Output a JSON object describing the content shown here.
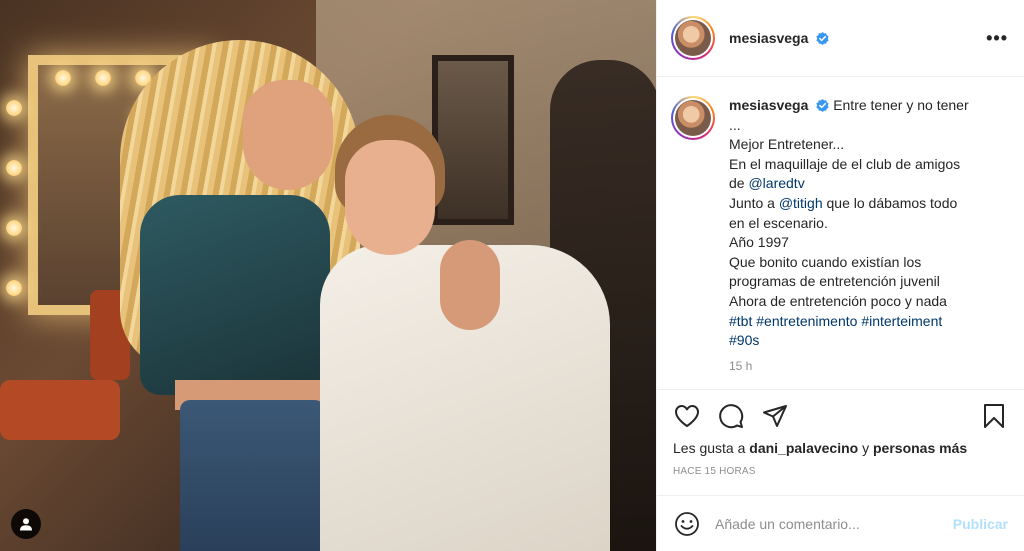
{
  "post": {
    "username": "mesiasvega",
    "more_icon": "more-horizontal-icon",
    "verified_color": "#3897f0"
  },
  "caption": {
    "username": "mesiasvega",
    "lines": [
      "Entre tener y no tener",
      "...",
      "Mejor Entretener...",
      "En el maquillaje de el club de amigos",
      "de "
    ],
    "mention1": "@laredtv",
    "line_junto_a": "Junto a ",
    "mention2": "@titigh",
    "line_junto_rest": " que lo dábamos todo",
    "line_en_escenario": "en el escenario.",
    "line_ano": "Año 1997",
    "line_que_bonito": "Que bonito cuando existían los",
    "line_programas": "programas de entretención juvenil",
    "line_ahora": "Ahora de entretención poco y nada",
    "hashtags_line1": [
      "#tbt",
      "#entretenimento",
      "#interteiment"
    ],
    "hashtags_line2": [
      "#90s"
    ],
    "time": "15 h"
  },
  "actions": {
    "like_icon": "heart-icon",
    "comment_icon": "comment-icon",
    "share_icon": "share-icon",
    "save_icon": "bookmark-icon"
  },
  "likes": {
    "prefix": "Les gusta a ",
    "user": "dani_palavecino",
    "middle": " y ",
    "suffix": "personas más"
  },
  "timestamp": "HACE 15 HORAS",
  "comment_box": {
    "placeholder": "Añade un comentario...",
    "publish_label": "Publicar",
    "emoji_icon": "emoji-icon"
  }
}
